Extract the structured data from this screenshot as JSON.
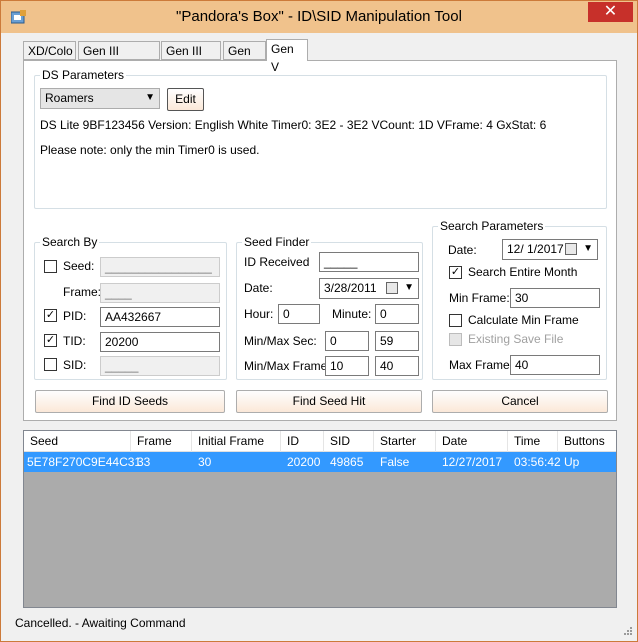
{
  "window": {
    "title": "\"Pandora's Box\" - ID\\SID Manipulation Tool",
    "close_glyph": "✕"
  },
  "tabs": [
    {
      "label": "XD/Colo"
    },
    {
      "label": "Gen III FRLGE"
    },
    {
      "label": "Gen III RS"
    },
    {
      "label": "Gen IV"
    },
    {
      "label": "Gen V"
    }
  ],
  "ds_params": {
    "group_label": "DS Parameters",
    "profile_selected": "Roamers",
    "edit_label": "Edit",
    "info_text": "DS Lite 9BF123456 Version: English White Timer0: 3E2 - 3E2 VCount: 1D VFrame: 4 GxStat: 6",
    "note_text": "Please note: only the min Timer0 is used."
  },
  "search_by": {
    "group_label": "Search By",
    "seed_label": "Seed:",
    "seed_value": "________________",
    "frame_label": "Frame:",
    "frame_value": "____",
    "pid_label": "PID:",
    "pid_value": "AA432667",
    "tid_label": "TID:",
    "tid_value": "20200",
    "sid_label": "SID:",
    "sid_value": "_____"
  },
  "seed_finder": {
    "group_label": "Seed Finder",
    "id_received_label": "ID Received",
    "id_received_value": "_____",
    "date_label": "Date:",
    "date_value": "3/28/2011",
    "hour_label": "Hour:",
    "hour_value": "0",
    "minute_label": "Minute:",
    "minute_value": "0",
    "minmax_sec_label": "Min/Max Sec:",
    "min_sec": "0",
    "max_sec": "59",
    "minmax_frame_label": "Min/Max Frame:",
    "min_frame": "10",
    "max_frame": "40"
  },
  "search_params": {
    "group_label": "Search Parameters",
    "date_label": "Date:",
    "date_value": "12/  1/2017",
    "entire_month_label": "Search Entire Month",
    "min_frame_label": "Min Frame:",
    "min_frame_value": "30",
    "calc_min_frame_label": "Calculate Min Frame",
    "existing_save_label": "Existing Save File",
    "max_frame_label": "Max Frame:",
    "max_frame_value": "40"
  },
  "checks": {
    "on": "✓",
    "off": ""
  },
  "buttons": {
    "find_id": "Find ID Seeds",
    "find_seed_hit": "Find Seed Hit",
    "cancel": "Cancel"
  },
  "results": {
    "columns": [
      "Seed",
      "Frame",
      "Initial Frame",
      "ID",
      "SID",
      "Starter",
      "Date",
      "Time",
      "Buttons"
    ],
    "rows": [
      [
        "5E78F270C9E44C31",
        "33",
        "30",
        "20200",
        "49865",
        "False",
        "12/27/2017",
        "03:56:42",
        "Up"
      ]
    ]
  },
  "status": {
    "text": "Cancelled. - Awaiting Command"
  },
  "colors": {
    "titlebar": "#f0c28c",
    "close": "#c7302a",
    "selection": "#3399ff",
    "grid_bg": "#ababab"
  }
}
